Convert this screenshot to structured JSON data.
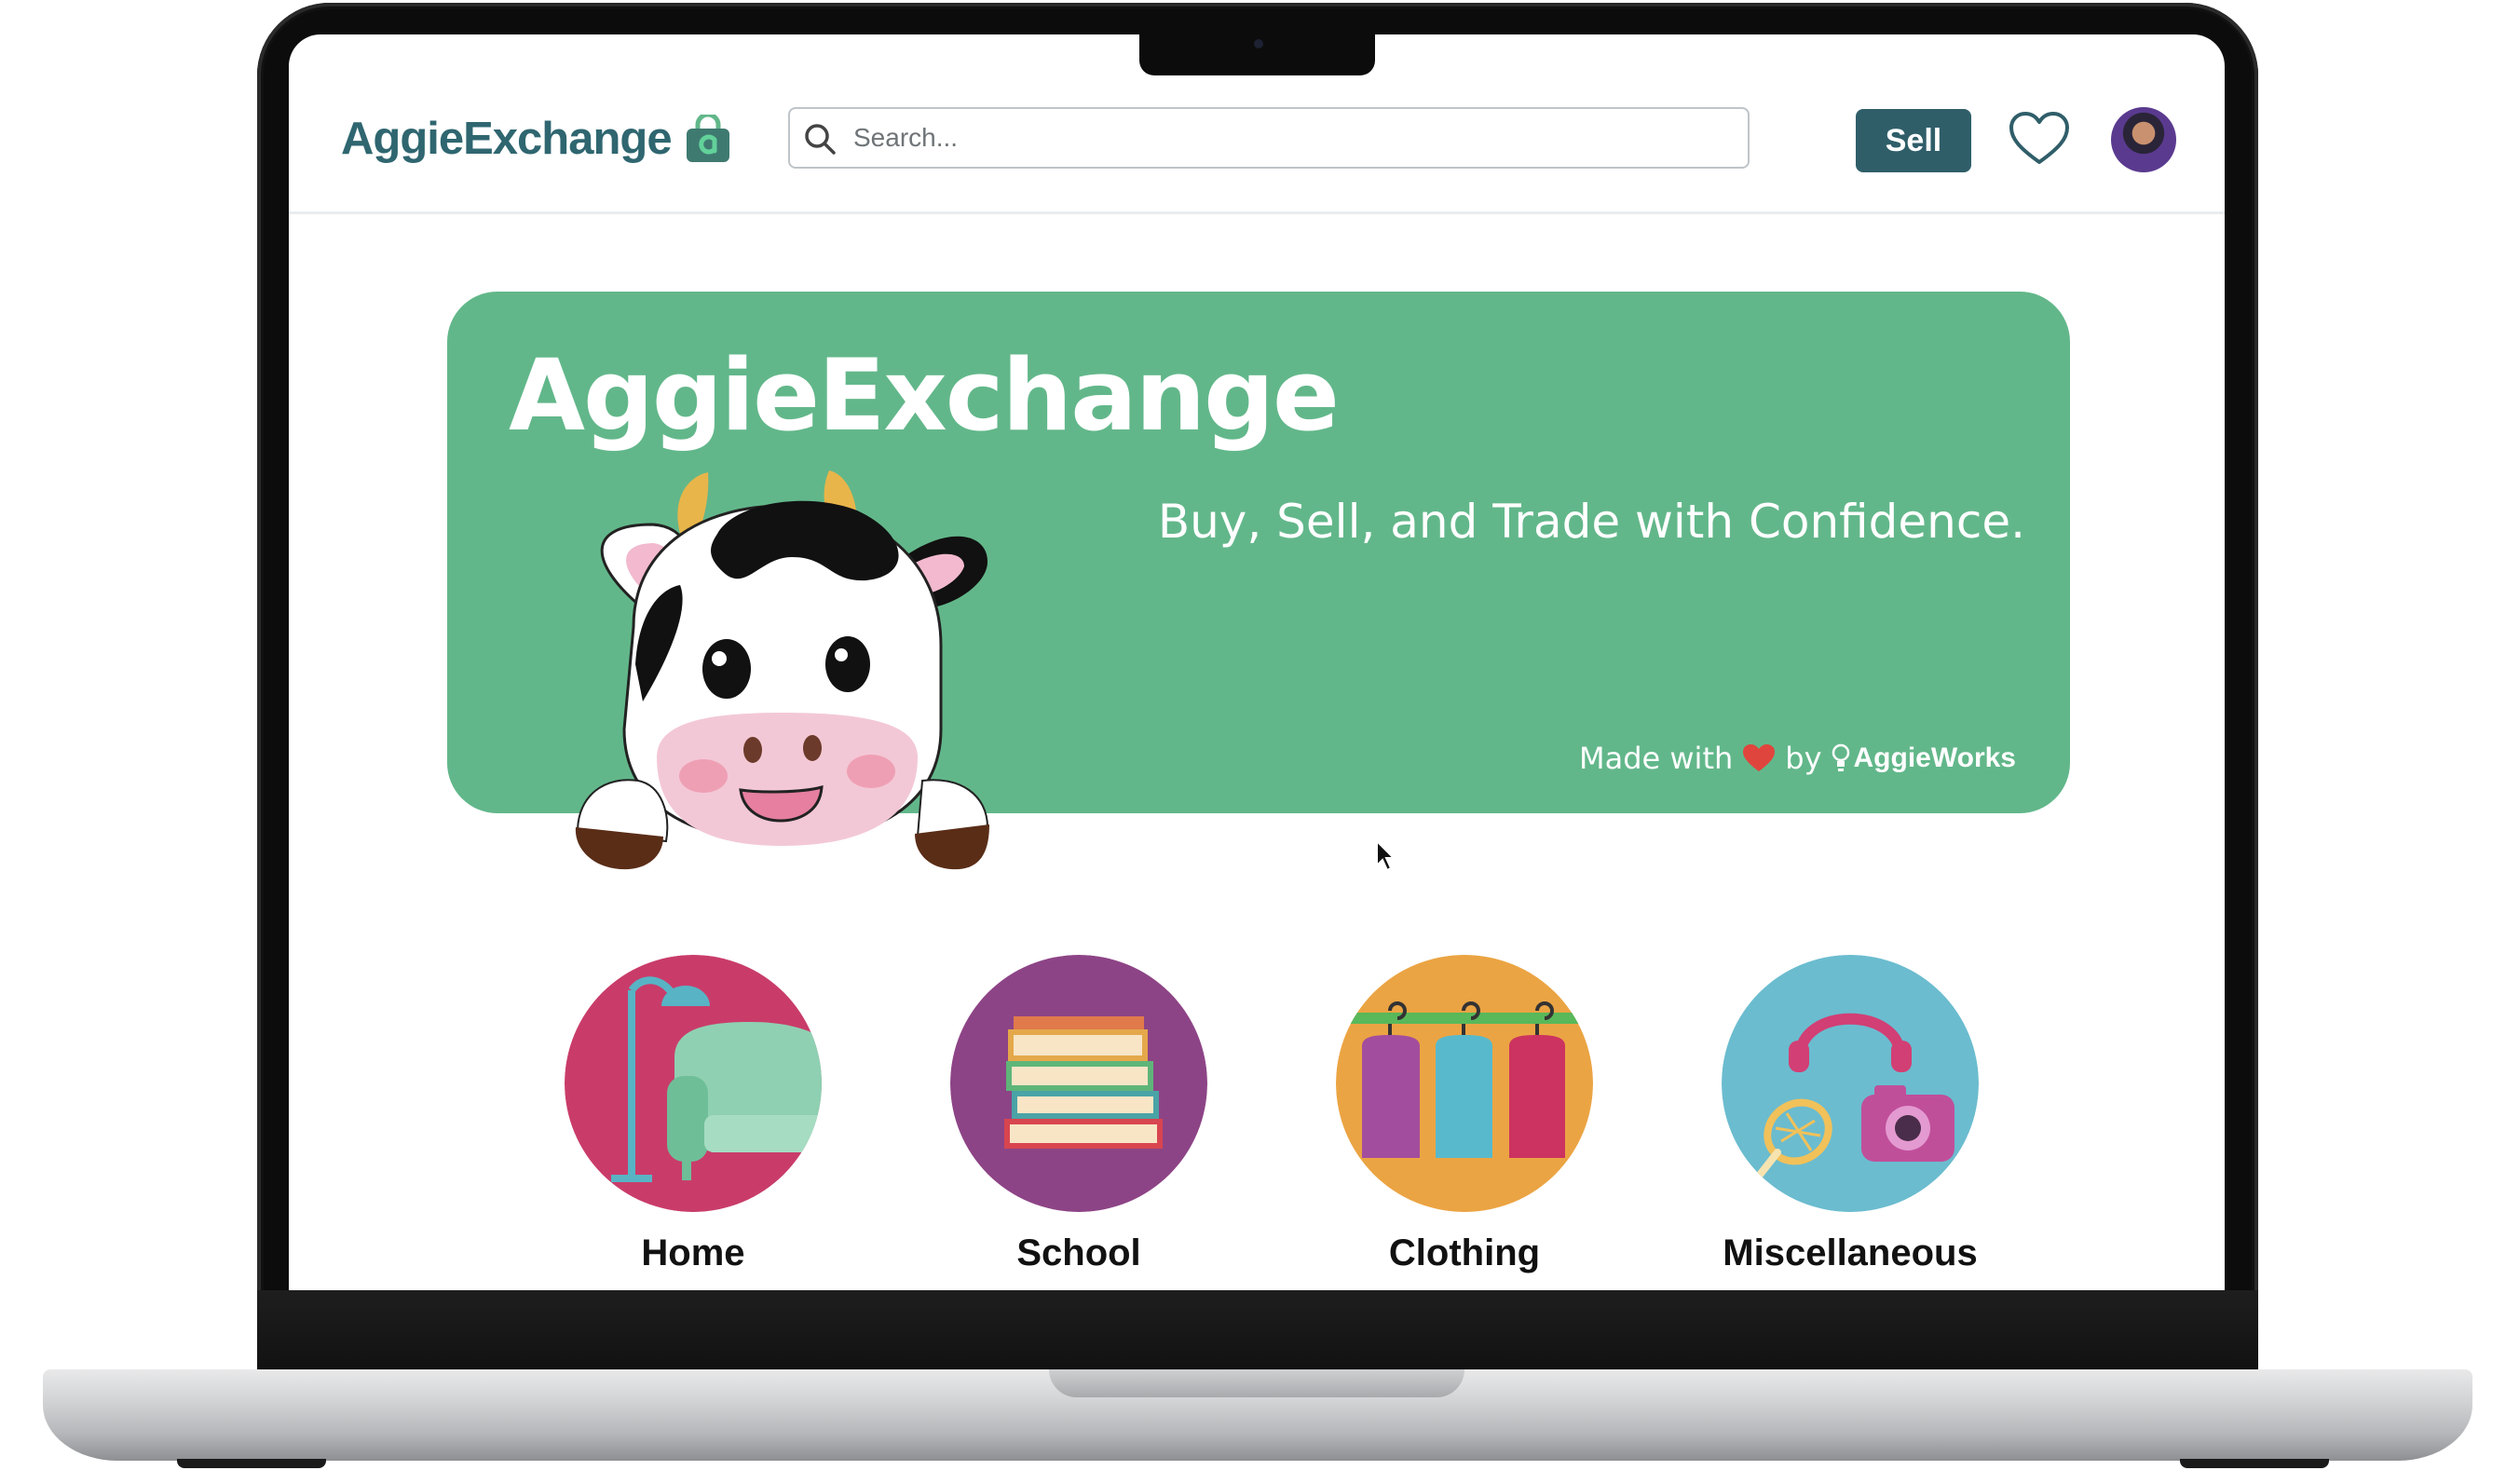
{
  "header": {
    "logo_text": "AggieExchange",
    "search_placeholder": "Search...",
    "sell_label": "Sell"
  },
  "hero": {
    "title": "AggieExchange",
    "tagline": "Buy, Sell, and Trade with Confidence.",
    "credit_prefix": "Made with",
    "credit_by": "by",
    "credit_brand": "AggieWorks"
  },
  "categories": [
    {
      "label": "Home",
      "color": "#c93c6a"
    },
    {
      "label": "School",
      "color": "#8d4486"
    },
    {
      "label": "Clothing",
      "color": "#eba443"
    },
    {
      "label": "Miscellaneous",
      "color": "#6bbccf"
    }
  ],
  "colors": {
    "brand": "#2f6670",
    "sell_button": "#2f5e69",
    "hero_green": "#62b78a"
  },
  "icons": [
    "bag-logo-icon",
    "search-icon",
    "heart-icon",
    "heart-emoji-icon",
    "lightbulb-icon",
    "cursor-icon"
  ]
}
